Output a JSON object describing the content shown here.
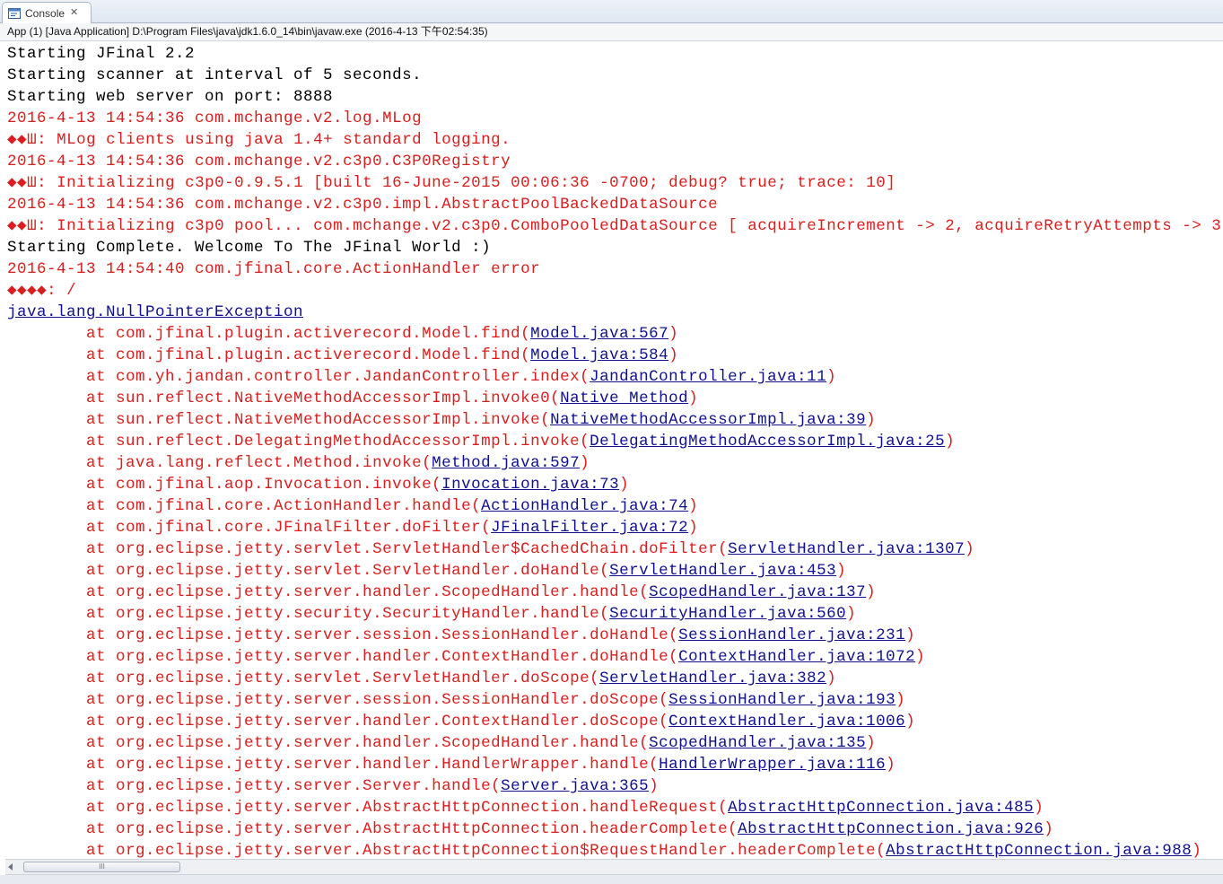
{
  "tab": {
    "label": "Console",
    "icon": "console-icon",
    "close_glyph": "✕"
  },
  "process_label": "App (1) [Java Application] D:\\Program Files\\java\\jdk1.6.0_14\\bin\\javaw.exe (2016-4-13 下午02:54:35)",
  "scrollbar": {
    "grip": "III"
  },
  "colors": {
    "stdout": "#000000",
    "stderr": "#d81e1e",
    "link": "#101090"
  },
  "console_lines": [
    {
      "type": "out",
      "text": "Starting JFinal 2.2"
    },
    {
      "type": "out",
      "text": "Starting scanner at interval of 5 seconds."
    },
    {
      "type": "out",
      "text": "Starting web server on port: 8888"
    },
    {
      "type": "err",
      "text": "2016-4-13 14:54:36 com.mchange.v2.log.MLog"
    },
    {
      "type": "err",
      "text": "◆◆Ш: MLog clients using java 1.4+ standard logging."
    },
    {
      "type": "err",
      "text": "2016-4-13 14:54:36 com.mchange.v2.c3p0.C3P0Registry"
    },
    {
      "type": "err",
      "text": "◆◆Ш: Initializing c3p0-0.9.5.1 [built 16-June-2015 00:06:36 -0700; debug? true; trace: 10]"
    },
    {
      "type": "err",
      "text": "2016-4-13 14:54:36 com.mchange.v2.c3p0.impl.AbstractPoolBackedDataSource"
    },
    {
      "type": "err",
      "text": "◆◆Ш: Initializing c3p0 pool... com.mchange.v2.c3p0.ComboPooledDataSource [ acquireIncrement -> 2, acquireRetryAttempts -> 3"
    },
    {
      "type": "out",
      "text": "Starting Complete. Welcome To The JFinal World :)"
    },
    {
      "type": "err",
      "text": "2016-4-13 14:54:40 com.jfinal.core.ActionHandler error"
    },
    {
      "type": "err",
      "text": "◆◆◆◆: /"
    },
    {
      "type": "exception",
      "link": "java.lang.NullPointerException"
    },
    {
      "type": "frame",
      "prefix": "\tat com.jfinal.plugin.activerecord.Model.find(",
      "link": "Model.java:567",
      "suffix": ")"
    },
    {
      "type": "frame",
      "prefix": "\tat com.jfinal.plugin.activerecord.Model.find(",
      "link": "Model.java:584",
      "suffix": ")"
    },
    {
      "type": "frame",
      "prefix": "\tat com.yh.jandan.controller.JandanController.index(",
      "link": "JandanController.java:11",
      "suffix": ")"
    },
    {
      "type": "frame",
      "prefix": "\tat sun.reflect.NativeMethodAccessorImpl.invoke0(",
      "link": "Native Method",
      "suffix": ")"
    },
    {
      "type": "frame",
      "prefix": "\tat sun.reflect.NativeMethodAccessorImpl.invoke(",
      "link": "NativeMethodAccessorImpl.java:39",
      "suffix": ")"
    },
    {
      "type": "frame",
      "prefix": "\tat sun.reflect.DelegatingMethodAccessorImpl.invoke(",
      "link": "DelegatingMethodAccessorImpl.java:25",
      "suffix": ")"
    },
    {
      "type": "frame",
      "prefix": "\tat java.lang.reflect.Method.invoke(",
      "link": "Method.java:597",
      "suffix": ")"
    },
    {
      "type": "frame",
      "prefix": "\tat com.jfinal.aop.Invocation.invoke(",
      "link": "Invocation.java:73",
      "suffix": ")"
    },
    {
      "type": "frame",
      "prefix": "\tat com.jfinal.core.ActionHandler.handle(",
      "link": "ActionHandler.java:74",
      "suffix": ")"
    },
    {
      "type": "frame",
      "prefix": "\tat com.jfinal.core.JFinalFilter.doFilter(",
      "link": "JFinalFilter.java:72",
      "suffix": ")"
    },
    {
      "type": "frame",
      "prefix": "\tat org.eclipse.jetty.servlet.ServletHandler$CachedChain.doFilter(",
      "link": "ServletHandler.java:1307",
      "suffix": ")"
    },
    {
      "type": "frame",
      "prefix": "\tat org.eclipse.jetty.servlet.ServletHandler.doHandle(",
      "link": "ServletHandler.java:453",
      "suffix": ")"
    },
    {
      "type": "frame",
      "prefix": "\tat org.eclipse.jetty.server.handler.ScopedHandler.handle(",
      "link": "ScopedHandler.java:137",
      "suffix": ")"
    },
    {
      "type": "frame",
      "prefix": "\tat org.eclipse.jetty.security.SecurityHandler.handle(",
      "link": "SecurityHandler.java:560",
      "suffix": ")"
    },
    {
      "type": "frame",
      "prefix": "\tat org.eclipse.jetty.server.session.SessionHandler.doHandle(",
      "link": "SessionHandler.java:231",
      "suffix": ")"
    },
    {
      "type": "frame",
      "prefix": "\tat org.eclipse.jetty.server.handler.ContextHandler.doHandle(",
      "link": "ContextHandler.java:1072",
      "suffix": ")"
    },
    {
      "type": "frame",
      "prefix": "\tat org.eclipse.jetty.servlet.ServletHandler.doScope(",
      "link": "ServletHandler.java:382",
      "suffix": ")"
    },
    {
      "type": "frame",
      "prefix": "\tat org.eclipse.jetty.server.session.SessionHandler.doScope(",
      "link": "SessionHandler.java:193",
      "suffix": ")"
    },
    {
      "type": "frame",
      "prefix": "\tat org.eclipse.jetty.server.handler.ContextHandler.doScope(",
      "link": "ContextHandler.java:1006",
      "suffix": ")"
    },
    {
      "type": "frame",
      "prefix": "\tat org.eclipse.jetty.server.handler.ScopedHandler.handle(",
      "link": "ScopedHandler.java:135",
      "suffix": ")"
    },
    {
      "type": "frame",
      "prefix": "\tat org.eclipse.jetty.server.handler.HandlerWrapper.handle(",
      "link": "HandlerWrapper.java:116",
      "suffix": ")"
    },
    {
      "type": "frame",
      "prefix": "\tat org.eclipse.jetty.server.Server.handle(",
      "link": "Server.java:365",
      "suffix": ")"
    },
    {
      "type": "frame",
      "prefix": "\tat org.eclipse.jetty.server.AbstractHttpConnection.handleRequest(",
      "link": "AbstractHttpConnection.java:485",
      "suffix": ")"
    },
    {
      "type": "frame",
      "prefix": "\tat org.eclipse.jetty.server.AbstractHttpConnection.headerComplete(",
      "link": "AbstractHttpConnection.java:926",
      "suffix": ")"
    },
    {
      "type": "frame",
      "prefix": "\tat org.eclipse.jetty.server.AbstractHttpConnection$RequestHandler.headerComplete(",
      "link": "AbstractHttpConnection.java:988",
      "suffix": ")"
    }
  ]
}
